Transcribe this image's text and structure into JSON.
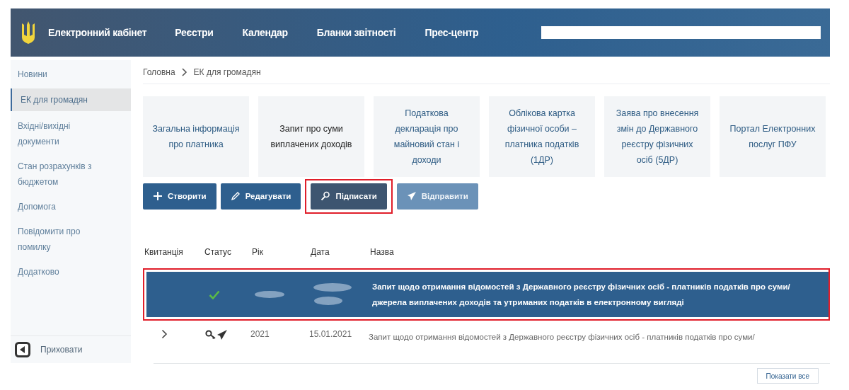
{
  "header": {
    "title": "Електронний кабінет",
    "nav": [
      "Реєстри",
      "Календар",
      "Бланки звітності",
      "Прес-центр"
    ]
  },
  "sidebar": {
    "items": [
      {
        "label": "Новини",
        "selected": false
      },
      {
        "label": "ЕК для громадян",
        "selected": true
      },
      {
        "label": "Вхідні/вихідні документи",
        "selected": false
      },
      {
        "label": "Стан розрахунків з бюджетом",
        "selected": false
      },
      {
        "label": "Допомога",
        "selected": false
      },
      {
        "label": "Повідомити про помилку",
        "selected": false
      },
      {
        "label": "Додатково",
        "selected": false
      }
    ],
    "hide": "Приховати"
  },
  "breadcrumb": [
    "Головна",
    "ЕК для громадян"
  ],
  "cards": [
    {
      "label": "Загальна інформація про платника",
      "selected": false
    },
    {
      "label": "Запит про суми виплачених доходів",
      "selected": true
    },
    {
      "label": "Податкова декларація про майновий стан і доходи",
      "selected": false
    },
    {
      "label": "Облікова картка фізичної особи – платника податків (1ДР)",
      "selected": false
    },
    {
      "label": "Заява про внесення змін до Державного реєстру фізичних осіб (5ДР)",
      "selected": false
    },
    {
      "label": "Портал Електронних послуг ПФУ",
      "selected": false
    }
  ],
  "buttons": [
    {
      "label": "Створити",
      "kind": "plus",
      "disabled": false,
      "highlighted": false
    },
    {
      "label": "Редагувати",
      "kind": "pencil",
      "disabled": false,
      "highlighted": false
    },
    {
      "label": "Підписати",
      "kind": "key",
      "disabled": false,
      "highlighted": true
    },
    {
      "label": "Відправити",
      "kind": "send",
      "disabled": true,
      "highlighted": false
    }
  ],
  "table": {
    "columns": [
      "Квитанція",
      "Статус",
      "Рік",
      "Дата",
      "Назва"
    ],
    "rows": [
      {
        "selected": true,
        "highlighted": true,
        "expander": false,
        "kind": "done",
        "redacted": true,
        "name": "Запит щодо отримання відомостей з Державного реєстру фізичних осіб - платників податків про суми/ джерела виплачених доходів та утриманих податків в електронному вигляді"
      },
      {
        "selected": false,
        "highlighted": false,
        "expander": true,
        "kind": "sent",
        "redacted": false,
        "year": "2021",
        "date": "15.01.2021",
        "name": "Запит щодо отримання відомостей з Державного реєстру фізичних осіб - платників податків про суми/"
      }
    ]
  },
  "footer": {
    "button": "Показати все"
  }
}
